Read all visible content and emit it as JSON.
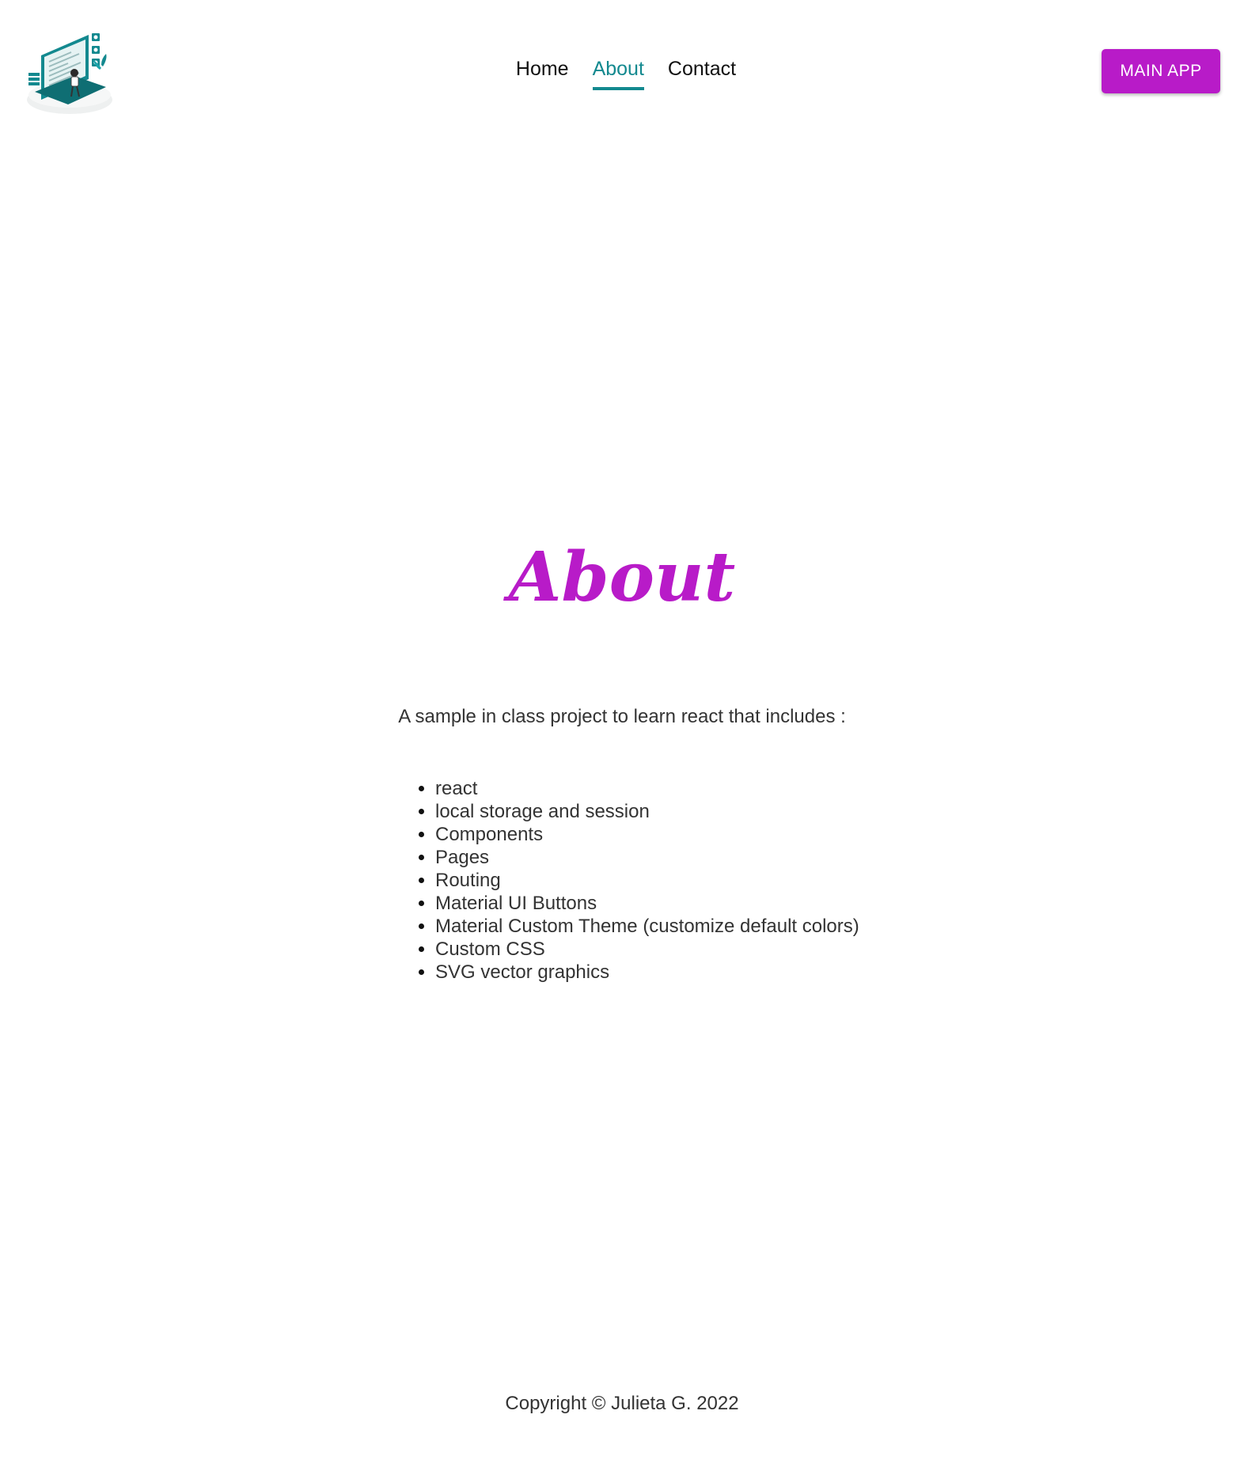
{
  "header": {
    "logo_icon": "developer-workstation-illustration",
    "nav": [
      {
        "label": "Home",
        "active": false
      },
      {
        "label": "About",
        "active": true
      },
      {
        "label": "Contact",
        "active": false
      }
    ],
    "main_app_label": "MAIN APP"
  },
  "main": {
    "title": "About",
    "intro": "A sample in class project to learn react that includes :",
    "features": [
      "react",
      "local storage and session",
      "Components",
      "Pages",
      "Routing",
      "Material UI Buttons",
      "Material Custom Theme (customize default colors)",
      "Custom CSS",
      "SVG vector graphics"
    ]
  },
  "footer": {
    "copyright": "Copyright © Julieta G. 2022"
  },
  "colors": {
    "accent": "#b81bc8",
    "nav_active": "#13898f",
    "text": "#333333"
  }
}
